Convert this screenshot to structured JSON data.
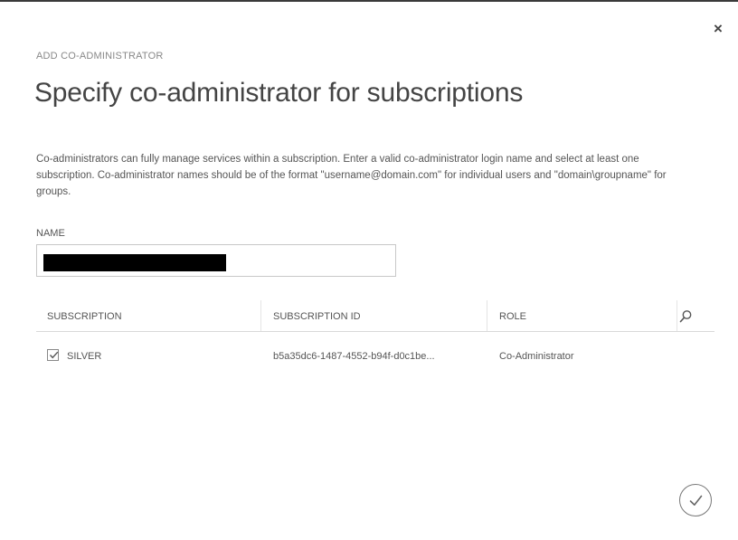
{
  "dialog": {
    "close_glyph": "×",
    "eyebrow": "ADD CO-ADMINISTRATOR",
    "title": "Specify co-administrator for subscriptions",
    "description": "Co-administrators can fully manage services within a subscription. Enter a valid co-administrator login name and select at least one subscription. Co-administrator names should be of the format \"username@domain.com\" for individual users and \"domain\\groupname\" for groups.",
    "name_label": "NAME",
    "name_value": "",
    "table": {
      "columns": [
        "SUBSCRIPTION",
        "SUBSCRIPTION ID",
        "ROLE"
      ],
      "rows": [
        {
          "checked": true,
          "subscription": "SILVER",
          "subscription_id": "b5a35dc6-1487-4552-b94f-d0c1be...",
          "role": "Co-Administrator"
        }
      ]
    },
    "icons": {
      "close": "close-icon",
      "search": "search-icon",
      "confirm": "checkmark-icon"
    },
    "colors": {
      "top_border": "#3a3a3a",
      "text": "#555555",
      "title": "#444444",
      "redaction": "#000000"
    }
  }
}
